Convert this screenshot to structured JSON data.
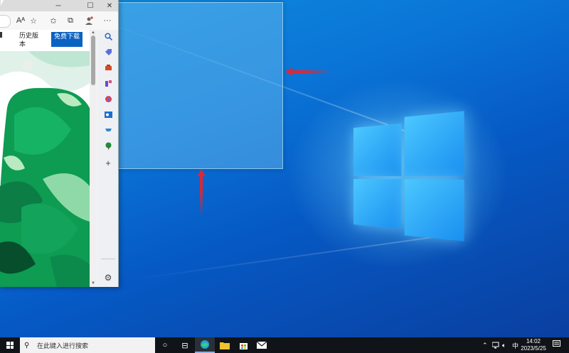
{
  "browser": {
    "title_buttons": {
      "minimize": "─",
      "maximize": "☐",
      "close": "✕"
    },
    "toolbar_icons": [
      "read-aloud-icon",
      "favorite-add-icon",
      "favorites-icon",
      "collections-icon",
      "profile-icon",
      "more-icon"
    ],
    "read_aloud_label": "Aᴬ",
    "more_label": "···",
    "page": {
      "history_link": "历史版本",
      "download_button": "免费下载"
    },
    "sidebar_icons": [
      "search-icon",
      "tag-icon",
      "toolbox-icon",
      "games-icon",
      "office-icon",
      "outlook-icon",
      "shopping-icon",
      "tree-icon",
      "add-icon",
      "settings-icon"
    ],
    "colors": {
      "download_bg": "#0b62c2",
      "accent_red": "#d8283a"
    }
  },
  "taskbar": {
    "search_placeholder": "在此键入进行搜索",
    "apps": [
      "task-view-icon",
      "widgets-icon",
      "edge-icon",
      "file-explorer-icon",
      "store-icon",
      "mail-icon"
    ],
    "tray": {
      "ime": "中",
      "time": "14:02",
      "date": "2023/5/25"
    }
  }
}
